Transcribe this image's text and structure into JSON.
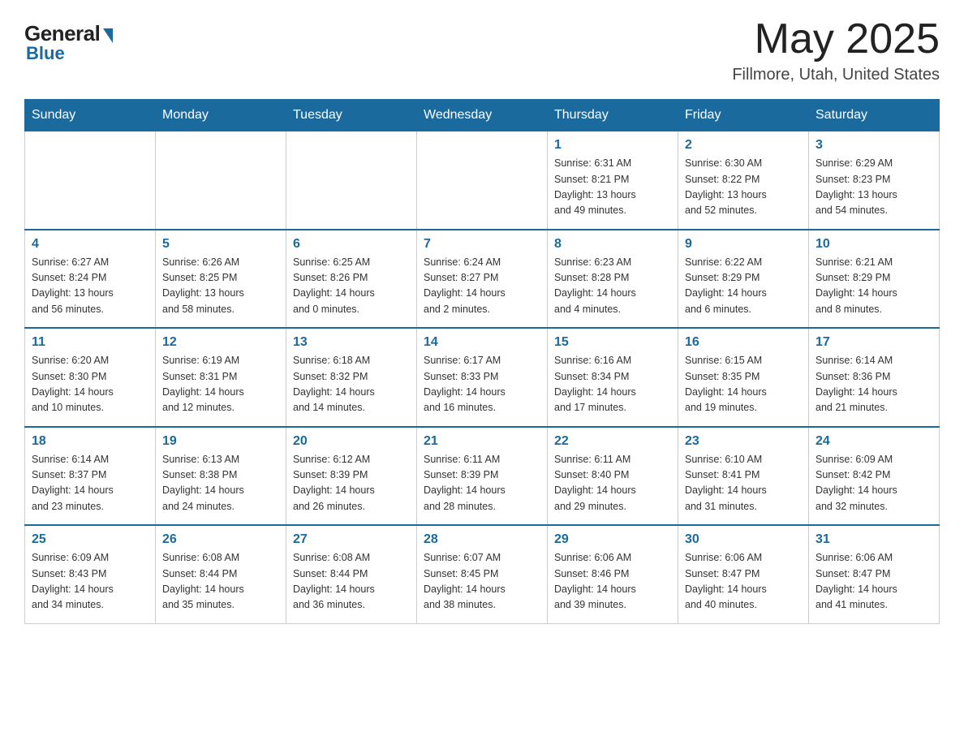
{
  "header": {
    "logo_general": "General",
    "logo_blue": "Blue",
    "month_title": "May 2025",
    "location": "Fillmore, Utah, United States"
  },
  "days_of_week": [
    "Sunday",
    "Monday",
    "Tuesday",
    "Wednesday",
    "Thursday",
    "Friday",
    "Saturday"
  ],
  "weeks": [
    [
      {
        "num": "",
        "info": ""
      },
      {
        "num": "",
        "info": ""
      },
      {
        "num": "",
        "info": ""
      },
      {
        "num": "",
        "info": ""
      },
      {
        "num": "1",
        "info": "Sunrise: 6:31 AM\nSunset: 8:21 PM\nDaylight: 13 hours\nand 49 minutes."
      },
      {
        "num": "2",
        "info": "Sunrise: 6:30 AM\nSunset: 8:22 PM\nDaylight: 13 hours\nand 52 minutes."
      },
      {
        "num": "3",
        "info": "Sunrise: 6:29 AM\nSunset: 8:23 PM\nDaylight: 13 hours\nand 54 minutes."
      }
    ],
    [
      {
        "num": "4",
        "info": "Sunrise: 6:27 AM\nSunset: 8:24 PM\nDaylight: 13 hours\nand 56 minutes."
      },
      {
        "num": "5",
        "info": "Sunrise: 6:26 AM\nSunset: 8:25 PM\nDaylight: 13 hours\nand 58 minutes."
      },
      {
        "num": "6",
        "info": "Sunrise: 6:25 AM\nSunset: 8:26 PM\nDaylight: 14 hours\nand 0 minutes."
      },
      {
        "num": "7",
        "info": "Sunrise: 6:24 AM\nSunset: 8:27 PM\nDaylight: 14 hours\nand 2 minutes."
      },
      {
        "num": "8",
        "info": "Sunrise: 6:23 AM\nSunset: 8:28 PM\nDaylight: 14 hours\nand 4 minutes."
      },
      {
        "num": "9",
        "info": "Sunrise: 6:22 AM\nSunset: 8:29 PM\nDaylight: 14 hours\nand 6 minutes."
      },
      {
        "num": "10",
        "info": "Sunrise: 6:21 AM\nSunset: 8:29 PM\nDaylight: 14 hours\nand 8 minutes."
      }
    ],
    [
      {
        "num": "11",
        "info": "Sunrise: 6:20 AM\nSunset: 8:30 PM\nDaylight: 14 hours\nand 10 minutes."
      },
      {
        "num": "12",
        "info": "Sunrise: 6:19 AM\nSunset: 8:31 PM\nDaylight: 14 hours\nand 12 minutes."
      },
      {
        "num": "13",
        "info": "Sunrise: 6:18 AM\nSunset: 8:32 PM\nDaylight: 14 hours\nand 14 minutes."
      },
      {
        "num": "14",
        "info": "Sunrise: 6:17 AM\nSunset: 8:33 PM\nDaylight: 14 hours\nand 16 minutes."
      },
      {
        "num": "15",
        "info": "Sunrise: 6:16 AM\nSunset: 8:34 PM\nDaylight: 14 hours\nand 17 minutes."
      },
      {
        "num": "16",
        "info": "Sunrise: 6:15 AM\nSunset: 8:35 PM\nDaylight: 14 hours\nand 19 minutes."
      },
      {
        "num": "17",
        "info": "Sunrise: 6:14 AM\nSunset: 8:36 PM\nDaylight: 14 hours\nand 21 minutes."
      }
    ],
    [
      {
        "num": "18",
        "info": "Sunrise: 6:14 AM\nSunset: 8:37 PM\nDaylight: 14 hours\nand 23 minutes."
      },
      {
        "num": "19",
        "info": "Sunrise: 6:13 AM\nSunset: 8:38 PM\nDaylight: 14 hours\nand 24 minutes."
      },
      {
        "num": "20",
        "info": "Sunrise: 6:12 AM\nSunset: 8:39 PM\nDaylight: 14 hours\nand 26 minutes."
      },
      {
        "num": "21",
        "info": "Sunrise: 6:11 AM\nSunset: 8:39 PM\nDaylight: 14 hours\nand 28 minutes."
      },
      {
        "num": "22",
        "info": "Sunrise: 6:11 AM\nSunset: 8:40 PM\nDaylight: 14 hours\nand 29 minutes."
      },
      {
        "num": "23",
        "info": "Sunrise: 6:10 AM\nSunset: 8:41 PM\nDaylight: 14 hours\nand 31 minutes."
      },
      {
        "num": "24",
        "info": "Sunrise: 6:09 AM\nSunset: 8:42 PM\nDaylight: 14 hours\nand 32 minutes."
      }
    ],
    [
      {
        "num": "25",
        "info": "Sunrise: 6:09 AM\nSunset: 8:43 PM\nDaylight: 14 hours\nand 34 minutes."
      },
      {
        "num": "26",
        "info": "Sunrise: 6:08 AM\nSunset: 8:44 PM\nDaylight: 14 hours\nand 35 minutes."
      },
      {
        "num": "27",
        "info": "Sunrise: 6:08 AM\nSunset: 8:44 PM\nDaylight: 14 hours\nand 36 minutes."
      },
      {
        "num": "28",
        "info": "Sunrise: 6:07 AM\nSunset: 8:45 PM\nDaylight: 14 hours\nand 38 minutes."
      },
      {
        "num": "29",
        "info": "Sunrise: 6:06 AM\nSunset: 8:46 PM\nDaylight: 14 hours\nand 39 minutes."
      },
      {
        "num": "30",
        "info": "Sunrise: 6:06 AM\nSunset: 8:47 PM\nDaylight: 14 hours\nand 40 minutes."
      },
      {
        "num": "31",
        "info": "Sunrise: 6:06 AM\nSunset: 8:47 PM\nDaylight: 14 hours\nand 41 minutes."
      }
    ]
  ]
}
